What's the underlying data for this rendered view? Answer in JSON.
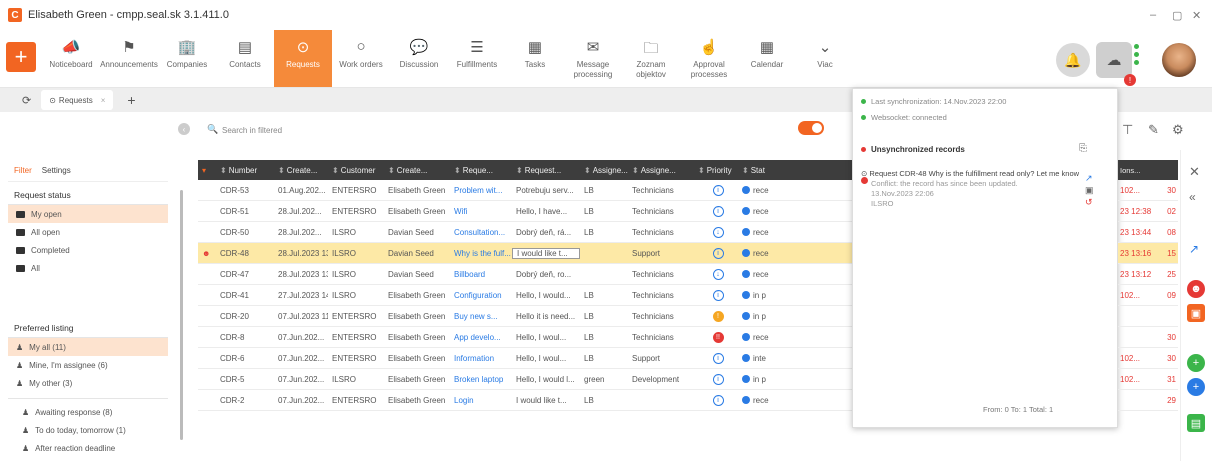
{
  "app": {
    "title": "Elisabeth Green - cmpp.seal.sk 3.1.411.0"
  },
  "ribbon": [
    {
      "label": "Noticeboard",
      "icon": "megaphone-icon"
    },
    {
      "label": "Announcements",
      "icon": "flag-icon"
    },
    {
      "label": "Companies",
      "icon": "building-icon"
    },
    {
      "label": "Contacts",
      "icon": "contact-card-icon"
    },
    {
      "label": "Requests",
      "icon": "check-circle-icon",
      "active": true
    },
    {
      "label": "Work orders",
      "icon": "circle-icon"
    },
    {
      "label": "Discussion",
      "icon": "chat-icon"
    },
    {
      "label": "Fulfillments",
      "icon": "lines-icon"
    },
    {
      "label": "Tasks",
      "icon": "tasks-icon"
    },
    {
      "label": "Message processing",
      "icon": "message-icon"
    },
    {
      "label": "Zoznam objektov",
      "icon": "folder-icon"
    },
    {
      "label": "Approval processes",
      "icon": "approval-icon"
    },
    {
      "label": "Calendar",
      "icon": "calendar-icon"
    },
    {
      "label": "Viac",
      "icon": "chevron-down-icon"
    }
  ],
  "tab": {
    "label": "Requests"
  },
  "search": {
    "placeholder": "Search in filtered"
  },
  "sidebar": {
    "tabs": [
      "Filter",
      "Settings"
    ],
    "request_status_title": "Request status",
    "status_items": [
      {
        "label": "My open",
        "selected": true
      },
      {
        "label": "All open"
      },
      {
        "label": "Completed"
      },
      {
        "label": "All"
      }
    ],
    "preferred_title": "Preferred listing",
    "preferred_items": [
      {
        "label": "My all (11)",
        "selected": true
      },
      {
        "label": "Mine, I'm assignee (6)"
      },
      {
        "label": "My other (3)"
      }
    ],
    "sub_items": [
      {
        "label": "Awaiting response (8)"
      },
      {
        "label": "To do today, tomorrow (1)"
      },
      {
        "label": "After reaction deadline"
      }
    ]
  },
  "grid": {
    "headers": [
      "Number",
      "Create...",
      "Customer",
      "Create...",
      "Reque...",
      "Request...",
      "Assigne...",
      "Assigne...",
      "Priority",
      "Stat"
    ],
    "rows": [
      {
        "num": "CDR-53",
        "date": "01.Aug.202...",
        "cust": "ENTERSRO",
        "creator": "Elisabeth Green",
        "req": "Problem wit...",
        "text": "Potrebuju serv...",
        "a1": "LB",
        "a2": "Technicians",
        "prio": "i",
        "stat": "rece"
      },
      {
        "num": "CDR-51",
        "date": "28.Jul.202...",
        "cust": "ENTERSRO",
        "creator": "Elisabeth Green",
        "req": "Wifi",
        "text": "Hello, I have...",
        "a1": "LB",
        "a2": "Technicians",
        "prio": "i",
        "stat": "rece"
      },
      {
        "num": "CDR-50",
        "date": "28.Jul.202...",
        "cust": "ILSRO",
        "creator": "Davian Seed",
        "req": "Consultation...",
        "text": "Dobrý deň, rá...",
        "a1": "LB",
        "a2": "Technicians",
        "prio": "↓",
        "stat": "rece"
      },
      {
        "num": "CDR-48",
        "date": "28.Jul.2023 13:14",
        "cust": "ILSRO",
        "creator": "Davian Seed",
        "req": "Why is the fulf...",
        "text": "I would like t...",
        "a1": "",
        "a2": "Support",
        "prio": "i",
        "stat": "rece",
        "hl": true
      },
      {
        "num": "CDR-47",
        "date": "28.Jul.2023 13:12",
        "cust": "ILSRO",
        "creator": "Davian Seed",
        "req": "Billboard",
        "text": "Dobrý deň, ro...",
        "a1": "",
        "a2": "Technicians",
        "prio": "↓",
        "stat": "rece"
      },
      {
        "num": "CDR-41",
        "date": "27.Jul.2023 14:16",
        "cust": "ILSRO",
        "creator": "Elisabeth Green",
        "req": "Configuration",
        "text": "Hello, I would...",
        "a1": "LB",
        "a2": "Technicians",
        "prio": "i",
        "stat": "in p"
      },
      {
        "num": "CDR-20",
        "date": "07.Jul.2023 11:25",
        "cust": "ENTERSRO",
        "creator": "Elisabeth Green",
        "req": "Buy new s...",
        "text": "Hello it is need...",
        "a1": "LB",
        "a2": "Technicians",
        "prio": "!",
        "stat": "in p",
        "pc": "or"
      },
      {
        "num": "CDR-8",
        "date": "07.Jun.202...",
        "cust": "ENTERSRO",
        "creator": "Elisabeth Green",
        "req": "App develo...",
        "text": "Hello, I woul...",
        "a1": "LB",
        "a2": "Technicians",
        "prio": "!!",
        "stat": "rece",
        "pc": "rd"
      },
      {
        "num": "CDR-6",
        "date": "07.Jun.202...",
        "cust": "ENTERSRO",
        "creator": "Elisabeth Green",
        "req": "Information",
        "text": "Hello, I woul...",
        "a1": "LB",
        "a2": "Support",
        "prio": "i",
        "stat": "inte"
      },
      {
        "num": "CDR-5",
        "date": "07.Jun.202...",
        "cust": "ILSRO",
        "creator": "Elisabeth Green",
        "req": "Broken laptop",
        "text": "Hello, I would l...",
        "a1": "green",
        "a2": "Development",
        "prio": "i",
        "stat": "in p"
      },
      {
        "num": "CDR-2",
        "date": "07.Jun.202...",
        "cust": "ENTERSRO",
        "creator": "Elisabeth Green",
        "req": "Login",
        "text": "I would like t...",
        "a1": "LB",
        "a2": "",
        "prio": "i",
        "stat": "rece"
      }
    ]
  },
  "popup": {
    "last_sync": "Last synchronization: 14.Nov.2023 22:00",
    "websocket": "Websocket: connected",
    "unsync_title": "Unsynchronized records",
    "record_title": "Request CDR-48 Why is the fulfillment read only? Let me know",
    "record_msg": "Conflict: the record has since been updated.",
    "record_time": "13.Nov.2023 22:06",
    "record_user": "ILSRO",
    "footer": "From: 0  To: 1  Total: 1"
  },
  "right_cols": {
    "header": "Ions...",
    "rows": [
      [
        "102...",
        "30"
      ],
      [
        "23 12:38",
        "02"
      ],
      [
        "23 13:44",
        "08"
      ],
      [
        "23 13:16",
        "15"
      ],
      [
        "23 13:12",
        "25"
      ],
      [
        "102...",
        "09"
      ],
      [
        "",
        ""
      ],
      [
        "",
        "30"
      ],
      [
        "102...",
        "30"
      ],
      [
        "102...",
        "31"
      ],
      [
        "",
        "29"
      ]
    ]
  }
}
